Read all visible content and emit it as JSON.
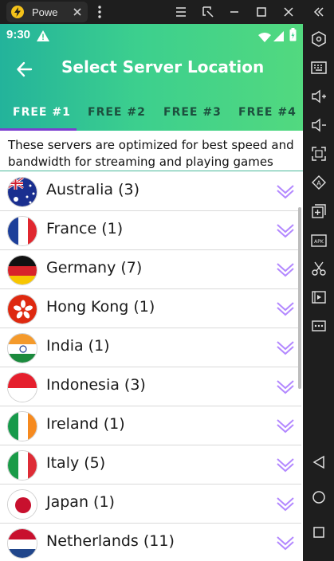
{
  "emulator": {
    "tab_title": "Powe",
    "sidebar_icons": [
      "hexagon-icon",
      "keyboard-icon",
      "volume-up-icon",
      "volume-down-icon",
      "fullscreen-icon",
      "rotate-icon",
      "add-screen-icon",
      "apk-icon",
      "cut-icon",
      "video-icon",
      "more-icon",
      "back-nav-icon",
      "home-nav-icon",
      "recent-nav-icon"
    ]
  },
  "status": {
    "time": "9:30"
  },
  "appbar": {
    "title": "Select Server Location"
  },
  "tabs": [
    {
      "label": "FREE #1",
      "active": true
    },
    {
      "label": "FREE #2",
      "active": false
    },
    {
      "label": "FREE #3",
      "active": false
    },
    {
      "label": "FREE #4",
      "active": false
    }
  ],
  "description": "These servers are optimized for best speed and bandwidth for streaming and playing games",
  "servers": [
    {
      "label": "Australia (3)",
      "flag": "au"
    },
    {
      "label": "France (1)",
      "flag": "fr"
    },
    {
      "label": "Germany (7)",
      "flag": "de"
    },
    {
      "label": "Hong Kong (1)",
      "flag": "hk"
    },
    {
      "label": "India (1)",
      "flag": "in"
    },
    {
      "label": "Indonesia (3)",
      "flag": "id"
    },
    {
      "label": "Ireland (1)",
      "flag": "ie"
    },
    {
      "label": "Italy (5)",
      "flag": "it"
    },
    {
      "label": "Japan (1)",
      "flag": "jp"
    },
    {
      "label": "Netherlands (11)",
      "flag": "nl"
    }
  ],
  "colors": {
    "accent": "#7b3fd0",
    "header_start": "#23b39b",
    "header_end": "#52d97f"
  }
}
